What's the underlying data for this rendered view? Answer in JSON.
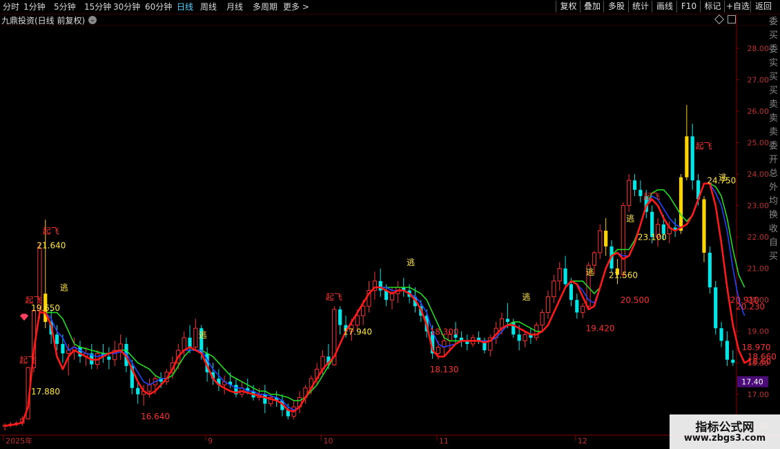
{
  "toolbar": {
    "periods": [
      {
        "label": "分时",
        "active": false
      },
      {
        "label": "1分钟",
        "active": false
      },
      {
        "label": "5分钟",
        "active": false
      },
      {
        "label": "15分钟",
        "active": false
      },
      {
        "label": "30分钟",
        "active": false
      },
      {
        "label": "60分钟",
        "active": false
      },
      {
        "label": "日线",
        "active": true
      },
      {
        "label": "周线",
        "active": false
      },
      {
        "label": "月线",
        "active": false
      },
      {
        "label": "多周期",
        "active": false
      },
      {
        "label": "更多 >",
        "active": false
      }
    ],
    "right_buttons": [
      "复权",
      "叠加",
      "多股",
      "统计",
      "画线",
      "F10",
      "标记",
      "+自选",
      "返回"
    ]
  },
  "title": "九鼎投资(日线 前复权)",
  "side_panel_chars": [
    "委",
    "买",
    "委",
    "实",
    "买",
    "买",
    "卖",
    "卖",
    "卖",
    "委",
    "开",
    "总",
    "外",
    "均",
    "换",
    "收",
    "自",
    "买"
  ],
  "watermark": {
    "line1": "指标公式网",
    "line2": "www.zbgs3.com"
  },
  "chart_data": {
    "type": "candlestick",
    "ylim": [
      15.7,
      28.7
    ],
    "y_ticks": [
      "16.00",
      "17.00",
      "18.00",
      "19.00",
      "20.00",
      "21.00",
      "22.00",
      "23.00",
      "24.00",
      "25.00",
      "26.00",
      "27.00",
      "28.00"
    ],
    "current_price": "17.40",
    "x_labels": [
      "2025年",
      "9",
      "10",
      "11",
      "12",
      "1"
    ],
    "x_label_positions": [
      0,
      35,
      55,
      75,
      99,
      129
    ],
    "colors": {
      "up": "#ff3232",
      "down": "#00e6e6",
      "red_line": "#ff1a1a",
      "green_line": "#22dd22",
      "blue_line": "#2244ff",
      "signal_bar": "#ffd400",
      "label_red": "#ff3030",
      "label_yellow": "#ffe640",
      "axis": "#8a0000"
    },
    "candles": [
      [
        15.98,
        16.08,
        15.85,
        16.02
      ],
      [
        16.02,
        16.12,
        15.95,
        16.05
      ],
      [
        16.05,
        16.15,
        15.98,
        16.08
      ],
      [
        16.08,
        16.3,
        16.0,
        16.22
      ],
      [
        16.22,
        17.88,
        16.2,
        17.85
      ],
      [
        17.85,
        19.68,
        17.7,
        19.65
      ],
      [
        19.65,
        21.8,
        19.4,
        21.64
      ],
      [
        20.2,
        22.55,
        19.1,
        19.3
      ],
      [
        19.3,
        19.7,
        18.6,
        18.9
      ],
      [
        18.9,
        19.2,
        18.4,
        18.6
      ],
      [
        18.6,
        18.9,
        18.0,
        18.3
      ],
      [
        18.3,
        18.6,
        17.6,
        18.4
      ],
      [
        18.4,
        18.8,
        18.1,
        18.5
      ],
      [
        18.5,
        18.7,
        18.0,
        18.2
      ],
      [
        18.2,
        18.5,
        17.9,
        18.3
      ],
      [
        18.3,
        18.6,
        17.8,
        17.95
      ],
      [
        17.95,
        18.4,
        17.8,
        18.3
      ],
      [
        18.3,
        18.6,
        18.0,
        18.2
      ],
      [
        18.2,
        18.5,
        17.8,
        18.1
      ],
      [
        18.1,
        18.7,
        17.9,
        18.4
      ],
      [
        18.4,
        18.9,
        18.1,
        18.6
      ],
      [
        18.6,
        18.8,
        17.7,
        17.9
      ],
      [
        17.9,
        18.1,
        17.0,
        17.2
      ],
      [
        17.2,
        17.4,
        16.7,
        17.0
      ],
      [
        17.0,
        17.3,
        16.64,
        17.1
      ],
      [
        17.1,
        17.5,
        16.9,
        17.3
      ],
      [
        17.3,
        17.6,
        17.0,
        17.5
      ],
      [
        17.5,
        17.7,
        17.2,
        17.4
      ],
      [
        17.4,
        17.8,
        17.3,
        17.7
      ],
      [
        17.7,
        18.2,
        17.5,
        18.0
      ],
      [
        18.0,
        18.6,
        17.8,
        18.4
      ],
      [
        18.4,
        19.0,
        18.2,
        18.8
      ],
      [
        18.8,
        19.2,
        18.3,
        18.5
      ],
      [
        18.5,
        19.4,
        18.4,
        19.1
      ],
      [
        19.1,
        19.2,
        18.1,
        18.3
      ],
      [
        18.3,
        18.5,
        17.4,
        17.7
      ],
      [
        17.7,
        18.0,
        17.3,
        17.5
      ],
      [
        17.5,
        17.8,
        17.1,
        17.3
      ],
      [
        17.3,
        17.6,
        17.0,
        17.4
      ],
      [
        17.4,
        17.7,
        17.2,
        17.3
      ],
      [
        17.3,
        17.5,
        16.9,
        17.0
      ],
      [
        17.0,
        17.4,
        16.9,
        17.2
      ],
      [
        17.2,
        17.5,
        17.0,
        17.1
      ],
      [
        17.1,
        17.3,
        16.8,
        16.9
      ],
      [
        16.9,
        17.2,
        16.8,
        17.0
      ],
      [
        17.0,
        17.3,
        16.4,
        16.7
      ],
      [
        16.7,
        17.0,
        16.6,
        16.9
      ],
      [
        16.9,
        17.1,
        16.6,
        16.8
      ],
      [
        16.8,
        17.0,
        16.3,
        16.5
      ],
      [
        16.5,
        16.7,
        16.2,
        16.3
      ],
      [
        16.3,
        16.8,
        16.2,
        16.6
      ],
      [
        16.6,
        17.1,
        16.4,
        16.9
      ],
      [
        16.9,
        17.3,
        16.7,
        17.2
      ],
      [
        17.2,
        17.6,
        17.0,
        17.5
      ],
      [
        17.5,
        18.0,
        17.3,
        17.8
      ],
      [
        17.8,
        18.4,
        17.6,
        18.2
      ],
      [
        18.2,
        18.6,
        17.8,
        17.94
      ],
      [
        17.94,
        19.8,
        17.9,
        19.7
      ],
      [
        19.7,
        19.8,
        18.9,
        19.2
      ],
      [
        19.2,
        19.5,
        18.8,
        19.0
      ],
      [
        19.0,
        19.4,
        18.7,
        19.2
      ],
      [
        19.2,
        19.7,
        19.0,
        19.5
      ],
      [
        19.5,
        20.0,
        19.2,
        19.8
      ],
      [
        19.8,
        20.6,
        19.6,
        20.3
      ],
      [
        20.3,
        20.9,
        20.0,
        20.6
      ],
      [
        20.6,
        21.0,
        20.1,
        20.3
      ],
      [
        20.3,
        20.5,
        19.8,
        20.0
      ],
      [
        20.0,
        20.4,
        19.7,
        20.2
      ],
      [
        20.2,
        20.6,
        19.9,
        20.4
      ],
      [
        20.4,
        20.7,
        20.1,
        20.3
      ],
      [
        20.3,
        20.5,
        19.9,
        20.1
      ],
      [
        20.1,
        20.4,
        19.6,
        19.8
      ],
      [
        19.8,
        20.0,
        19.3,
        19.5
      ],
      [
        19.5,
        19.7,
        18.8,
        19.0
      ],
      [
        19.0,
        19.2,
        18.13,
        18.3
      ],
      [
        18.3,
        18.7,
        18.1,
        18.5
      ],
      [
        18.5,
        18.9,
        18.2,
        18.7
      ],
      [
        18.7,
        19.0,
        18.4,
        18.9
      ],
      [
        18.9,
        19.3,
        18.6,
        18.8
      ],
      [
        18.8,
        19.0,
        18.5,
        18.7
      ],
      [
        18.7,
        18.9,
        18.4,
        18.6
      ],
      [
        18.6,
        18.9,
        18.5,
        18.8
      ],
      [
        18.8,
        19.0,
        18.6,
        18.7
      ],
      [
        18.7,
        18.8,
        18.3,
        18.4
      ],
      [
        18.4,
        18.9,
        18.2,
        18.8
      ],
      [
        18.8,
        19.3,
        18.6,
        19.1
      ],
      [
        19.1,
        19.6,
        18.9,
        19.4
      ],
      [
        19.4,
        19.9,
        19.1,
        19.3
      ],
      [
        19.3,
        19.4,
        18.8,
        18.9
      ],
      [
        18.9,
        19.2,
        18.4,
        18.7
      ],
      [
        18.7,
        19.0,
        18.5,
        18.9
      ],
      [
        18.9,
        19.1,
        18.6,
        18.8
      ],
      [
        18.8,
        19.3,
        18.7,
        19.2
      ],
      [
        19.2,
        19.7,
        19.0,
        19.6
      ],
      [
        19.6,
        20.3,
        19.4,
        20.1
      ],
      [
        20.1,
        20.8,
        19.9,
        20.6
      ],
      [
        20.6,
        21.2,
        20.3,
        21.0
      ],
      [
        21.0,
        21.4,
        20.4,
        20.5
      ],
      [
        20.5,
        20.7,
        19.8,
        20.0
      ],
      [
        20.0,
        20.2,
        19.4,
        19.6
      ],
      [
        19.6,
        19.9,
        19.42,
        19.8
      ],
      [
        19.8,
        21.2,
        19.7,
        21.1
      ],
      [
        21.1,
        21.56,
        20.8,
        21.5
      ],
      [
        21.5,
        22.4,
        21.3,
        22.2
      ],
      [
        22.2,
        22.6,
        21.4,
        21.7
      ],
      [
        21.7,
        21.9,
        20.9,
        21.0
      ],
      [
        21.0,
        21.3,
        20.5,
        20.8
      ],
      [
        20.8,
        23.1,
        20.7,
        23.0
      ],
      [
        23.0,
        24.0,
        22.8,
        23.8
      ],
      [
        23.8,
        24.0,
        23.3,
        23.5
      ],
      [
        23.5,
        23.8,
        23.1,
        23.3
      ],
      [
        23.3,
        23.5,
        22.6,
        22.8
      ],
      [
        22.8,
        23.0,
        21.8,
        22.0
      ],
      [
        22.0,
        22.6,
        21.7,
        22.4
      ],
      [
        22.4,
        22.7,
        21.9,
        22.1
      ],
      [
        22.1,
        22.5,
        21.8,
        22.3
      ],
      [
        22.3,
        22.6,
        22.0,
        22.2
      ],
      [
        22.2,
        24.0,
        22.1,
        23.9
      ],
      [
        23.9,
        26.2,
        23.8,
        25.2
      ],
      [
        25.2,
        25.6,
        23.5,
        23.8
      ],
      [
        23.8,
        24.0,
        23.0,
        23.2
      ],
      [
        23.2,
        23.3,
        21.2,
        21.5
      ],
      [
        21.5,
        21.7,
        20.2,
        20.4
      ],
      [
        20.4,
        20.6,
        18.9,
        19.1
      ],
      [
        19.1,
        19.3,
        18.5,
        18.7
      ],
      [
        18.7,
        19.0,
        17.9,
        18.1
      ],
      [
        18.1,
        18.4,
        17.9,
        18.0
      ]
    ],
    "red_line": [
      16.0,
      16.02,
      16.05,
      16.1,
      16.6,
      18.4,
      19.6,
      19.6,
      19.2,
      18.2,
      17.8,
      18.2,
      18.4,
      18.3,
      18.2,
      18.1,
      18.1,
      18.2,
      18.3,
      18.35,
      18.4,
      18.2,
      17.8,
      17.4,
      17.1,
      17.0,
      17.1,
      17.3,
      17.5,
      17.8,
      18.2,
      18.4,
      18.5,
      18.4,
      18.3,
      17.9,
      17.5,
      17.3,
      17.2,
      17.1,
      17.05,
      17.1,
      17.05,
      17.0,
      16.95,
      16.9,
      16.85,
      16.8,
      16.7,
      16.5,
      16.45,
      16.6,
      16.9,
      17.2,
      17.5,
      17.8,
      18.0,
      18.2,
      18.6,
      19.0,
      19.3,
      19.6,
      19.9,
      20.2,
      20.4,
      20.4,
      20.3,
      20.2,
      20.3,
      20.3,
      20.2,
      20.0,
      19.7,
      19.2,
      18.4,
      18.2,
      18.2,
      18.4,
      18.6,
      18.7,
      18.7,
      18.7,
      18.7,
      18.65,
      18.7,
      18.9,
      19.1,
      19.2,
      19.2,
      19.1,
      19.0,
      18.9,
      18.9,
      19.0,
      19.2,
      19.6,
      20.0,
      20.4,
      20.6,
      20.5,
      20.1,
      19.7,
      19.8,
      20.4,
      21.0,
      21.4,
      21.5,
      21.3,
      21.4,
      21.8,
      22.4,
      23.0,
      23.2,
      23.0,
      22.6,
      22.3,
      22.2,
      22.3,
      22.4,
      22.7,
      23.2,
      23.7,
      23.7,
      23.0,
      21.8,
      20.4,
      19.2,
      18.4,
      18.0,
      18.1
    ],
    "green_line": [
      null,
      null,
      null,
      null,
      null,
      null,
      null,
      19.6,
      19.6,
      19.6,
      19.4,
      19.0,
      18.6,
      18.5,
      18.45,
      18.4,
      18.35,
      18.3,
      18.3,
      18.35,
      18.4,
      18.4,
      18.2,
      18.0,
      17.9,
      17.8,
      17.6,
      17.5,
      17.5,
      17.6,
      17.9,
      18.2,
      18.4,
      18.4,
      18.4,
      18.3,
      18.2,
      18.0,
      17.8,
      17.6,
      17.5,
      17.4,
      17.3,
      17.2,
      17.1,
      17.1,
      17.0,
      17.0,
      16.95,
      16.9,
      16.8,
      16.8,
      16.9,
      17.1,
      17.3,
      17.6,
      17.9,
      18.2,
      18.6,
      19.0,
      19.3,
      19.6,
      19.9,
      20.2,
      20.4,
      20.4,
      20.4,
      20.4,
      20.4,
      20.4,
      20.4,
      20.3,
      20.2,
      20.0,
      19.6,
      19.2,
      18.8,
      18.7,
      18.7,
      18.7,
      18.7,
      18.7,
      18.7,
      18.7,
      18.7,
      18.8,
      19.0,
      19.2,
      19.3,
      19.3,
      19.2,
      19.1,
      19.0,
      19.0,
      19.2,
      19.6,
      20.0,
      20.4,
      20.6,
      20.6,
      20.6,
      20.4,
      20.2,
      20.4,
      21.0,
      21.4,
      21.6,
      21.6,
      21.6,
      21.9,
      22.4,
      23.0,
      23.4,
      23.5,
      23.5,
      23.3,
      23.0,
      22.7,
      22.5,
      22.7,
      23.2,
      23.7,
      23.7,
      23.6,
      23.3,
      22.6,
      21.6,
      20.8,
      20.4
    ],
    "blue_line": [
      null,
      null,
      null,
      null,
      null,
      null,
      null,
      19.6,
      19.4,
      19.0,
      18.8,
      18.4,
      18.5,
      18.4,
      18.3,
      18.25,
      18.2,
      18.25,
      18.3,
      18.3,
      18.35,
      18.3,
      18.0,
      17.7,
      17.4,
      17.3,
      17.4,
      17.5,
      17.5,
      17.8,
      18.2,
      18.4,
      18.4,
      18.4,
      18.4,
      18.1,
      17.8,
      17.6,
      17.4,
      17.3,
      17.2,
      17.2,
      17.1,
      17.1,
      17.0,
      17.0,
      16.95,
      16.9,
      16.8,
      16.6,
      16.5,
      16.6,
      16.9,
      17.2,
      17.5,
      17.8,
      18.0,
      18.2,
      18.6,
      19.0,
      19.3,
      19.6,
      19.9,
      20.2,
      20.4,
      20.4,
      20.4,
      20.3,
      20.3,
      20.3,
      20.2,
      20.1,
      19.9,
      19.6,
      19.0,
      18.6,
      18.5,
      18.55,
      18.6,
      18.7,
      18.7,
      18.7,
      18.7,
      18.7,
      18.7,
      18.8,
      19.0,
      19.2,
      19.2,
      19.1,
      19.0,
      18.9,
      18.9,
      19.0,
      19.2,
      19.6,
      20.0,
      20.4,
      20.6,
      20.5,
      20.3,
      20.0,
      19.9,
      20.4,
      21.0,
      21.4,
      21.5,
      21.4,
      21.4,
      21.8,
      22.4,
      23.0,
      23.3,
      23.2,
      22.9,
      22.6,
      22.4,
      22.3,
      22.4,
      22.7,
      23.2,
      23.7,
      23.7,
      23.4,
      23.0,
      22.2,
      21.0,
      20.0,
      19.5
    ],
    "signal_bars": [
      7,
      104,
      106,
      117,
      118,
      121
    ],
    "annotations": [
      {
        "i": 6,
        "v": 21.64,
        "text": "21.640",
        "color": "yellow"
      },
      {
        "i": 7,
        "v": 22.1,
        "text": "起飞",
        "color": "red"
      },
      {
        "i": 5,
        "v": 19.65,
        "text": "19.650",
        "color": "yellow"
      },
      {
        "i": 4,
        "v": 19.9,
        "text": "起飞",
        "color": "red"
      },
      {
        "i": 3,
        "v": 18.0,
        "text": "起飞",
        "color": "red"
      },
      {
        "i": 5,
        "v": 17.0,
        "text": "17.880",
        "color": "yellow"
      },
      {
        "i": 10,
        "v": 20.3,
        "text": "逃",
        "color": "yellow"
      },
      {
        "i": 24,
        "v": 16.2,
        "text": "16.640",
        "color": "red"
      },
      {
        "i": 34,
        "v": 18.8,
        "text": "逃",
        "color": "yellow"
      },
      {
        "i": 56,
        "v": 20.0,
        "text": "起飞",
        "color": "red"
      },
      {
        "i": 59,
        "v": 18.9,
        "text": "17.940",
        "color": "yellow"
      },
      {
        "i": 70,
        "v": 21.1,
        "text": "逃",
        "color": "yellow"
      },
      {
        "i": 74,
        "v": 18.9,
        "text": "18.300",
        "color": "red"
      },
      {
        "i": 74,
        "v": 17.7,
        "text": "18.130",
        "color": "red"
      },
      {
        "i": 90,
        "v": 20.0,
        "text": "逃",
        "color": "yellow"
      },
      {
        "i": 101,
        "v": 19.0,
        "text": "19.420",
        "color": "red"
      },
      {
        "i": 101,
        "v": 20.8,
        "text": "逃",
        "color": "yellow"
      },
      {
        "i": 105,
        "v": 20.7,
        "text": "21.560",
        "color": "yellow"
      },
      {
        "i": 107,
        "v": 19.9,
        "text": "20.500",
        "color": "red"
      },
      {
        "i": 108,
        "v": 22.5,
        "text": "逃",
        "color": "yellow"
      },
      {
        "i": 110,
        "v": 21.9,
        "text": "23.100",
        "color": "yellow"
      },
      {
        "i": 111,
        "v": 23.2,
        "text": "起飞",
        "color": "red"
      },
      {
        "i": 120,
        "v": 24.8,
        "text": "起飞",
        "color": "red"
      },
      {
        "i": 122,
        "v": 23.7,
        "text": "24.750",
        "color": "yellow"
      },
      {
        "i": 124,
        "v": 23.8,
        "text": "逃",
        "color": "yellow"
      },
      {
        "i": 126,
        "v": 19.9,
        "text": "20.910",
        "color": "red"
      },
      {
        "i": 127,
        "v": 19.7,
        "text": "20.230",
        "color": "red"
      },
      {
        "i": 128,
        "v": 18.4,
        "text": "18.970",
        "color": "red"
      },
      {
        "i": 129,
        "v": 18.1,
        "text": "18.660",
        "color": "red"
      },
      {
        "i": 129,
        "v": 17.95,
        "text": "18.60",
        "color": "red"
      }
    ]
  }
}
